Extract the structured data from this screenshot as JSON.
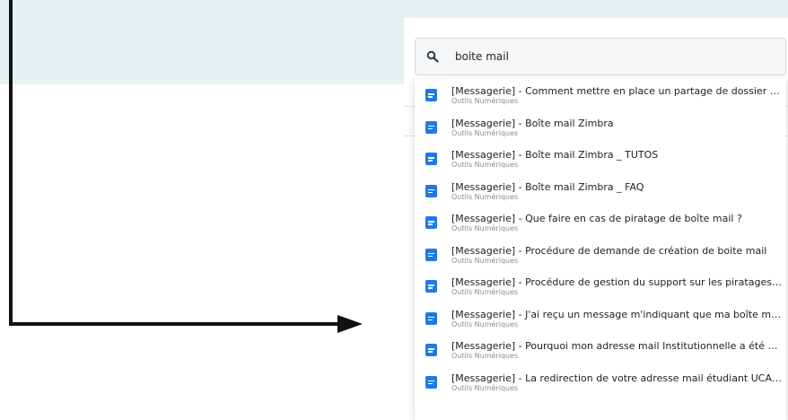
{
  "search": {
    "value": "boite mail",
    "icon": "search-icon"
  },
  "results": [
    {
      "title": "[Messagerie] - Comment mettre en place un partage de dossier d'une...",
      "category": "Outils Numériques",
      "icon": "document-icon"
    },
    {
      "title": "[Messagerie] - Boîte mail Zimbra",
      "category": "Outils Numériques",
      "icon": "document-icon"
    },
    {
      "title": "[Messagerie] - Boîte mail Zimbra _ TUTOS",
      "category": "Outils Numériques",
      "icon": "document-icon"
    },
    {
      "title": "[Messagerie] - Boîte mail Zimbra _ FAQ",
      "category": "Outils Numériques",
      "icon": "document-icon"
    },
    {
      "title": "[Messagerie] - Que faire en cas de piratage de boîte mail ?",
      "category": "Outils Numériques",
      "icon": "document-icon"
    },
    {
      "title": "[Messagerie] - Procédure de demande de création de boite mail",
      "category": "Outils Numériques",
      "icon": "document-icon"
    },
    {
      "title": "[Messagerie] - Procédure de gestion du support sur les piratages de b...",
      "category": "Outils Numériques",
      "icon": "document-icon"
    },
    {
      "title": "[Messagerie] - J'ai reçu un message m'indiquant que ma boîte mail a ...",
      "category": "Outils Numériques",
      "icon": "document-icon"
    },
    {
      "title": "[Messagerie] - Pourquoi mon adresse mail Institutionnelle a été modif...",
      "category": "Outils Numériques",
      "icon": "document-icon"
    },
    {
      "title": "[Messagerie] - La redirection de votre adresse mail étudiant UCA est-...",
      "category": "Outils Numériques",
      "icon": "document-icon"
    }
  ],
  "colors": {
    "accent": "#1f79e8",
    "band": "#e8f1f2",
    "arrow": "#111111"
  }
}
